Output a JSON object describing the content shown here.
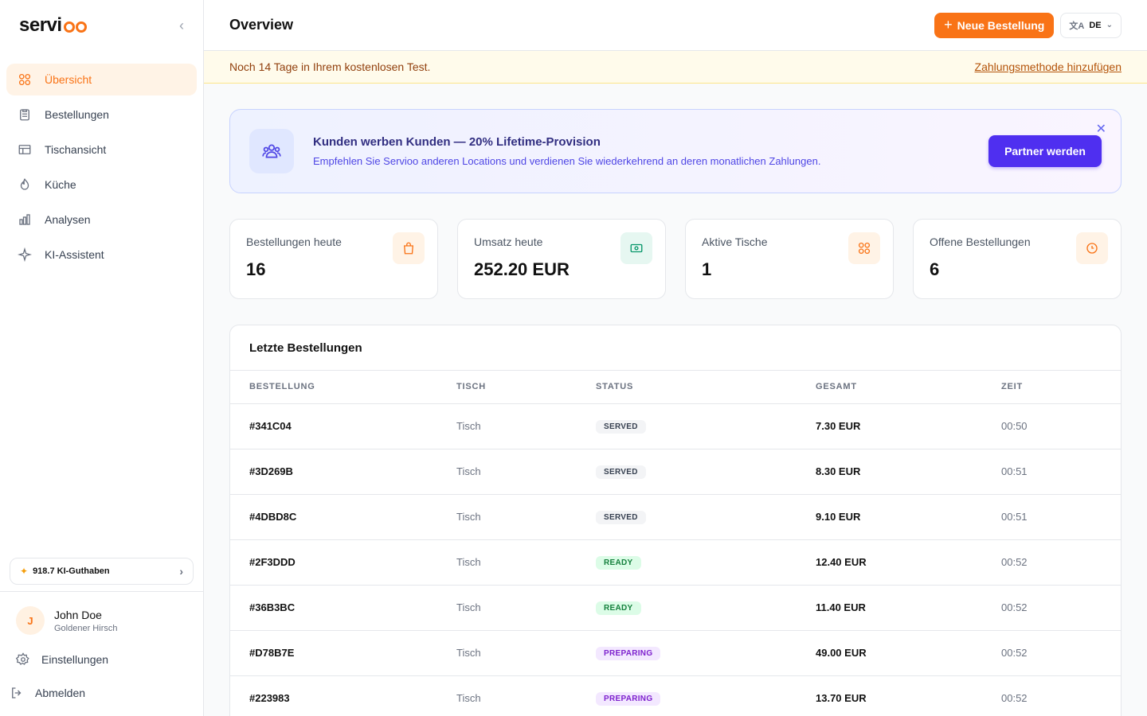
{
  "brand": {
    "name_prefix": "servi",
    "name_suffix": "oo"
  },
  "header": {
    "title": "Overview",
    "new_order_label": "Neue Bestellung",
    "language": "DE"
  },
  "trial": {
    "message": "Noch 14 Tage in Ihrem kostenlosen Test.",
    "link": "Zahlungsmethode hinzufügen"
  },
  "sidebar": {
    "items": [
      {
        "label": "Übersicht",
        "icon": "grid-icon",
        "active": true
      },
      {
        "label": "Bestellungen",
        "icon": "clipboard-icon",
        "active": false
      },
      {
        "label": "Tischansicht",
        "icon": "table-icon",
        "active": false
      },
      {
        "label": "Küche",
        "icon": "flame-icon",
        "active": false
      },
      {
        "label": "Analysen",
        "icon": "bar-chart-icon",
        "active": false
      },
      {
        "label": "KI-Assistent",
        "icon": "sparkle-icon",
        "active": false
      }
    ],
    "credits": "918.7 KI-Guthaben",
    "user": {
      "initial": "J",
      "name": "John Doe",
      "location": "Goldener Hirsch"
    },
    "settings": "Einstellungen",
    "logout": "Abmelden"
  },
  "referral": {
    "title": "Kunden werben Kunden — 20% Lifetime-Provision",
    "description": "Empfehlen Sie Servioo anderen Locations und verdienen Sie wiederkehrend an deren monatlichen Zahlungen.",
    "button": "Partner werden"
  },
  "stats": [
    {
      "label": "Bestellungen heute",
      "value": "16",
      "icon": "shopping-bag-icon",
      "color": "#f97316",
      "bg": "#fff3e6"
    },
    {
      "label": "Umsatz heute",
      "value": "252.20 EUR",
      "icon": "money-icon",
      "color": "#059669",
      "bg": "#e6f7f1"
    },
    {
      "label": "Aktive Tische",
      "value": "1",
      "icon": "grid-icon",
      "color": "#f97316",
      "bg": "#fff3e6"
    },
    {
      "label": "Offene Bestellungen",
      "value": "6",
      "icon": "clock-icon",
      "color": "#f97316",
      "bg": "#fff3e6"
    }
  ],
  "orders": {
    "title": "Letzte Bestellungen",
    "columns": [
      "BESTELLUNG",
      "TISCH",
      "STATUS",
      "GESAMT",
      "ZEIT"
    ],
    "rows": [
      {
        "id": "#341C04",
        "table": "Tisch",
        "status": "SERVED",
        "total": "7.30 EUR",
        "time": "00:50"
      },
      {
        "id": "#3D269B",
        "table": "Tisch",
        "status": "SERVED",
        "total": "8.30 EUR",
        "time": "00:51"
      },
      {
        "id": "#4DBD8C",
        "table": "Tisch",
        "status": "SERVED",
        "total": "9.10 EUR",
        "time": "00:51"
      },
      {
        "id": "#2F3DDD",
        "table": "Tisch",
        "status": "READY",
        "total": "12.40 EUR",
        "time": "00:52"
      },
      {
        "id": "#36B3BC",
        "table": "Tisch",
        "status": "READY",
        "total": "11.40 EUR",
        "time": "00:52"
      },
      {
        "id": "#D78B7E",
        "table": "Tisch",
        "status": "PREPARING",
        "total": "49.00 EUR",
        "time": "00:52"
      },
      {
        "id": "#223983",
        "table": "Tisch",
        "status": "PREPARING",
        "total": "13.70 EUR",
        "time": "00:52"
      }
    ]
  },
  "colors": {
    "accent": "#f97316",
    "indigo": "#4f2ff0"
  }
}
